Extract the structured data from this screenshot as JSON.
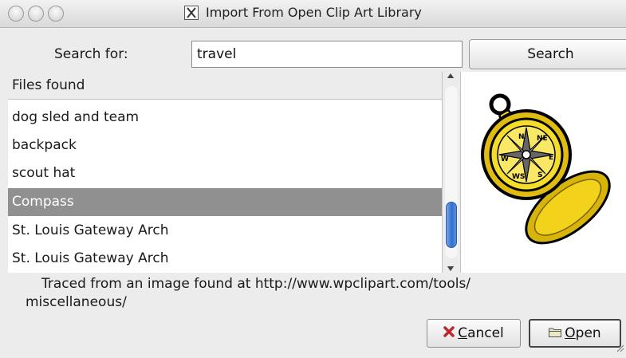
{
  "window": {
    "title": "Import From Open Clip Art Library"
  },
  "search": {
    "label": "Search for:",
    "value": "travel",
    "button_label": "Search"
  },
  "results": {
    "header": "Files found",
    "items": [
      {
        "label": "dog sled and team"
      },
      {
        "label": "backpack"
      },
      {
        "label": "scout hat"
      },
      {
        "label": "Compass",
        "selected": true
      },
      {
        "label": "St. Louis Gateway Arch"
      },
      {
        "label": "St. Louis Gateway Arch"
      }
    ]
  },
  "preview": {
    "compass_letters": [
      "N",
      "NE",
      "E",
      "S",
      "WS",
      "W"
    ]
  },
  "description": {
    "line1": "Traced from an image found at http://www.wpclipart.com/tools/",
    "line2": "miscellaneous/"
  },
  "buttons": {
    "cancel_first": "C",
    "cancel_rest": "ancel",
    "open_first": "O",
    "open_rest": "pen"
  },
  "icons": {
    "cancel": "cancel-x-icon",
    "open": "folder-icon",
    "title": "x11-icon"
  },
  "colors": {
    "selection": "#909090",
    "scroll_thumb": "#2f6fd1",
    "compass_gold": "#f2d21b"
  }
}
